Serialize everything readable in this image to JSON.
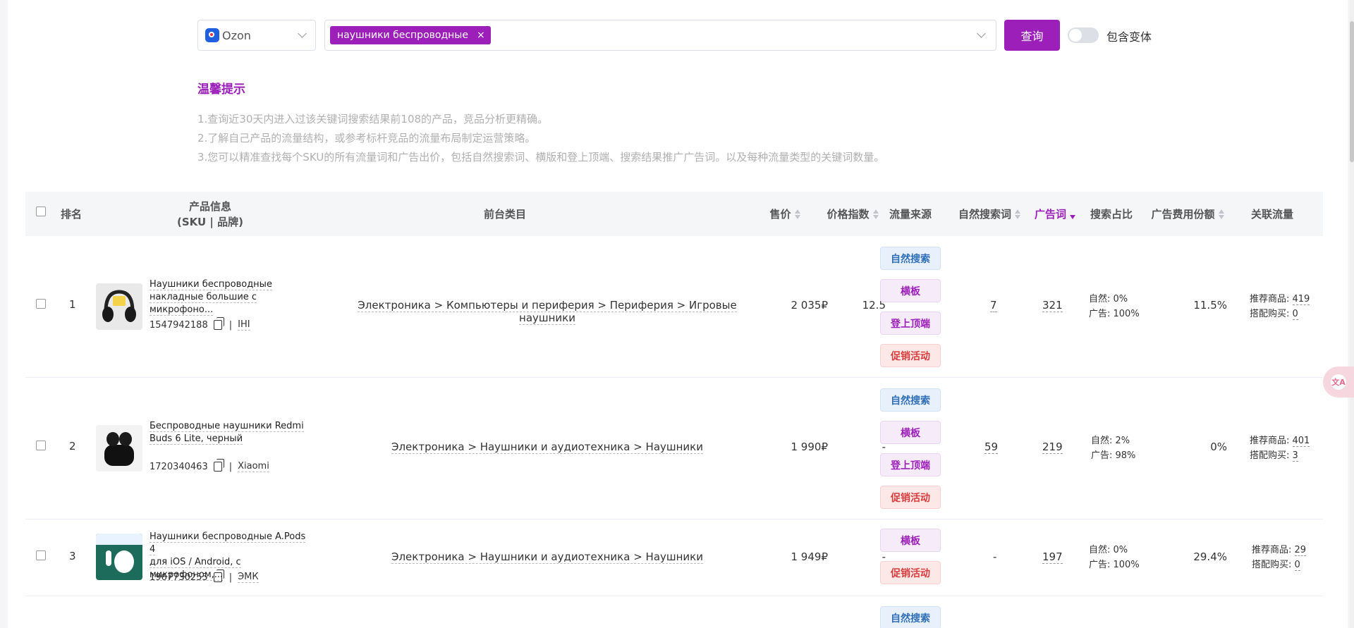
{
  "search": {
    "platform": "Ozon",
    "keyword_tag": "наушники беспроводные",
    "query_label": "查询",
    "variant_toggle_label": "包含变体"
  },
  "tips": {
    "title": "温馨提示",
    "lines": [
      "1.查询近30天内进入过该关键词搜索结果前108的产品，竞品分析更精确。",
      "2.了解自己产品的流量结构，或参考标杆竞品的流量布局制定运营策略。",
      "3.您可以精准查找每个SKU的所有流量词和广告出价，包括自然搜索词、横版和登上顶端、搜索结果推广广告词。以及每种流量类型的关键词数量。"
    ]
  },
  "table": {
    "headers": {
      "rank": "排名",
      "product_line1": "产品信息",
      "product_line2": "(SKU | 品牌)",
      "category": "前台类目",
      "price": "售价",
      "price_index": "价格指数",
      "traffic_source": "流量来源",
      "organic_words": "自然搜索词",
      "ad_words": "广告词",
      "search_share": "搜索占比",
      "ad_spend_share": "广告费用份额",
      "related_traffic": "关联流量"
    },
    "rows": [
      {
        "rank": "1",
        "title_line1": "Наушники беспроводные",
        "title_line2": "накладные большие с микрофоно...",
        "sku": "1547942188",
        "brand": "IHI",
        "category": "Электроника > Компьютеры и периферия > Периферия > Игровые наушники",
        "price": "2 035₽",
        "price_index": "12.5",
        "sources": [
          "自然搜索",
          "横板",
          "登上顶端",
          "促销活动"
        ],
        "organic_words": "7",
        "ad_words": "321",
        "share_organic": "自然: 0%",
        "share_ad": "广告: 100%",
        "ad_spend_share": "11.5%",
        "recommend_label": "推荐商品: ",
        "recommend_value": "419",
        "bundle_label": "搭配购买: ",
        "bundle_value": "0"
      },
      {
        "rank": "2",
        "title_line1": "Беспроводные наушники Redmi",
        "title_line2": "Buds 6 Lite, черный",
        "sku": "1720340463",
        "brand": "Xiaomi",
        "category": "Электроника > Наушники и аудиотехника > Наушники",
        "price": "1 990₽",
        "price_index": "-",
        "sources": [
          "自然搜索",
          "横板",
          "登上顶端",
          "促销活动"
        ],
        "organic_words": "59",
        "ad_words": "219",
        "share_organic": "自然: 2%",
        "share_ad": "广告: 98%",
        "ad_spend_share": "0%",
        "recommend_label": "推荐商品: ",
        "recommend_value": "401",
        "bundle_label": "搭配购买: ",
        "bundle_value": "3"
      },
      {
        "rank": "3",
        "title_line1": "Наушники беспроводные A.Pods 4",
        "title_line2": "для iOS / Android, с микрофоном,...",
        "sku": "1967730255",
        "brand": "ЭМК",
        "category": "Электроника > Наушники и аудиотехника > Наушники",
        "price": "1 949₽",
        "price_index": "-",
        "sources": [
          "横板",
          "促销活动"
        ],
        "organic_words": "-",
        "ad_words": "197",
        "share_organic": "自然: 0%",
        "share_ad": "广告: 100%",
        "ad_spend_share": "29.4%",
        "recommend_label": "推荐商品: ",
        "recommend_value": "29",
        "bundle_label": "搭配购买: ",
        "bundle_value": "0"
      },
      {
        "sources": [
          "自然搜索"
        ]
      }
    ]
  },
  "float_button": {
    "glyph": "文A"
  },
  "colors": {
    "accent": "#9b1fb8",
    "organic_tag": "#2f6fb8",
    "promo_tag": "#d93c3c"
  }
}
